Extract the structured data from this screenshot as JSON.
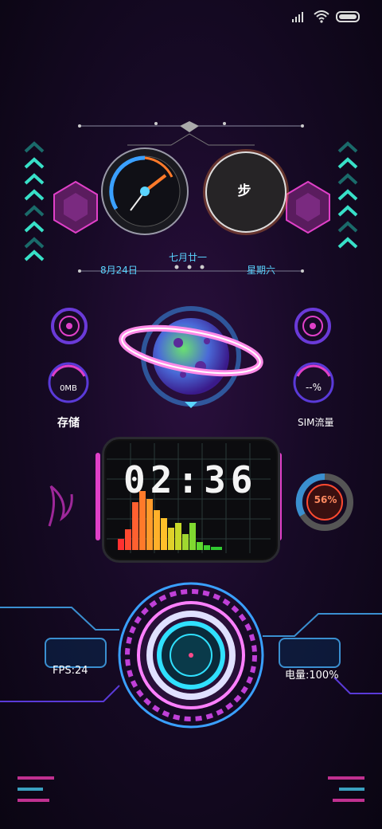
{
  "status": {
    "signal_icon": "signal-bars-icon",
    "wifi_icon": "wifi-icon",
    "battery_icon": "battery-icon"
  },
  "dashboard": {
    "step_label": "步",
    "date": "8月24日",
    "lunar_date": "七月廿一",
    "weekday": "星期六",
    "storage_value": "0MB",
    "storage_label": "存储",
    "sim_value": "--%",
    "sim_label": "SIM流量",
    "clock_time": "02:36",
    "battery_ring_value": "56%",
    "fps": "FPS:24",
    "battery_level": "电量:100%"
  },
  "colors": {
    "accent_cyan": "#38e0c8",
    "accent_magenta": "#e040c8",
    "accent_blue": "#3a8fd0",
    "accent_orange": "#ff7a2a"
  }
}
